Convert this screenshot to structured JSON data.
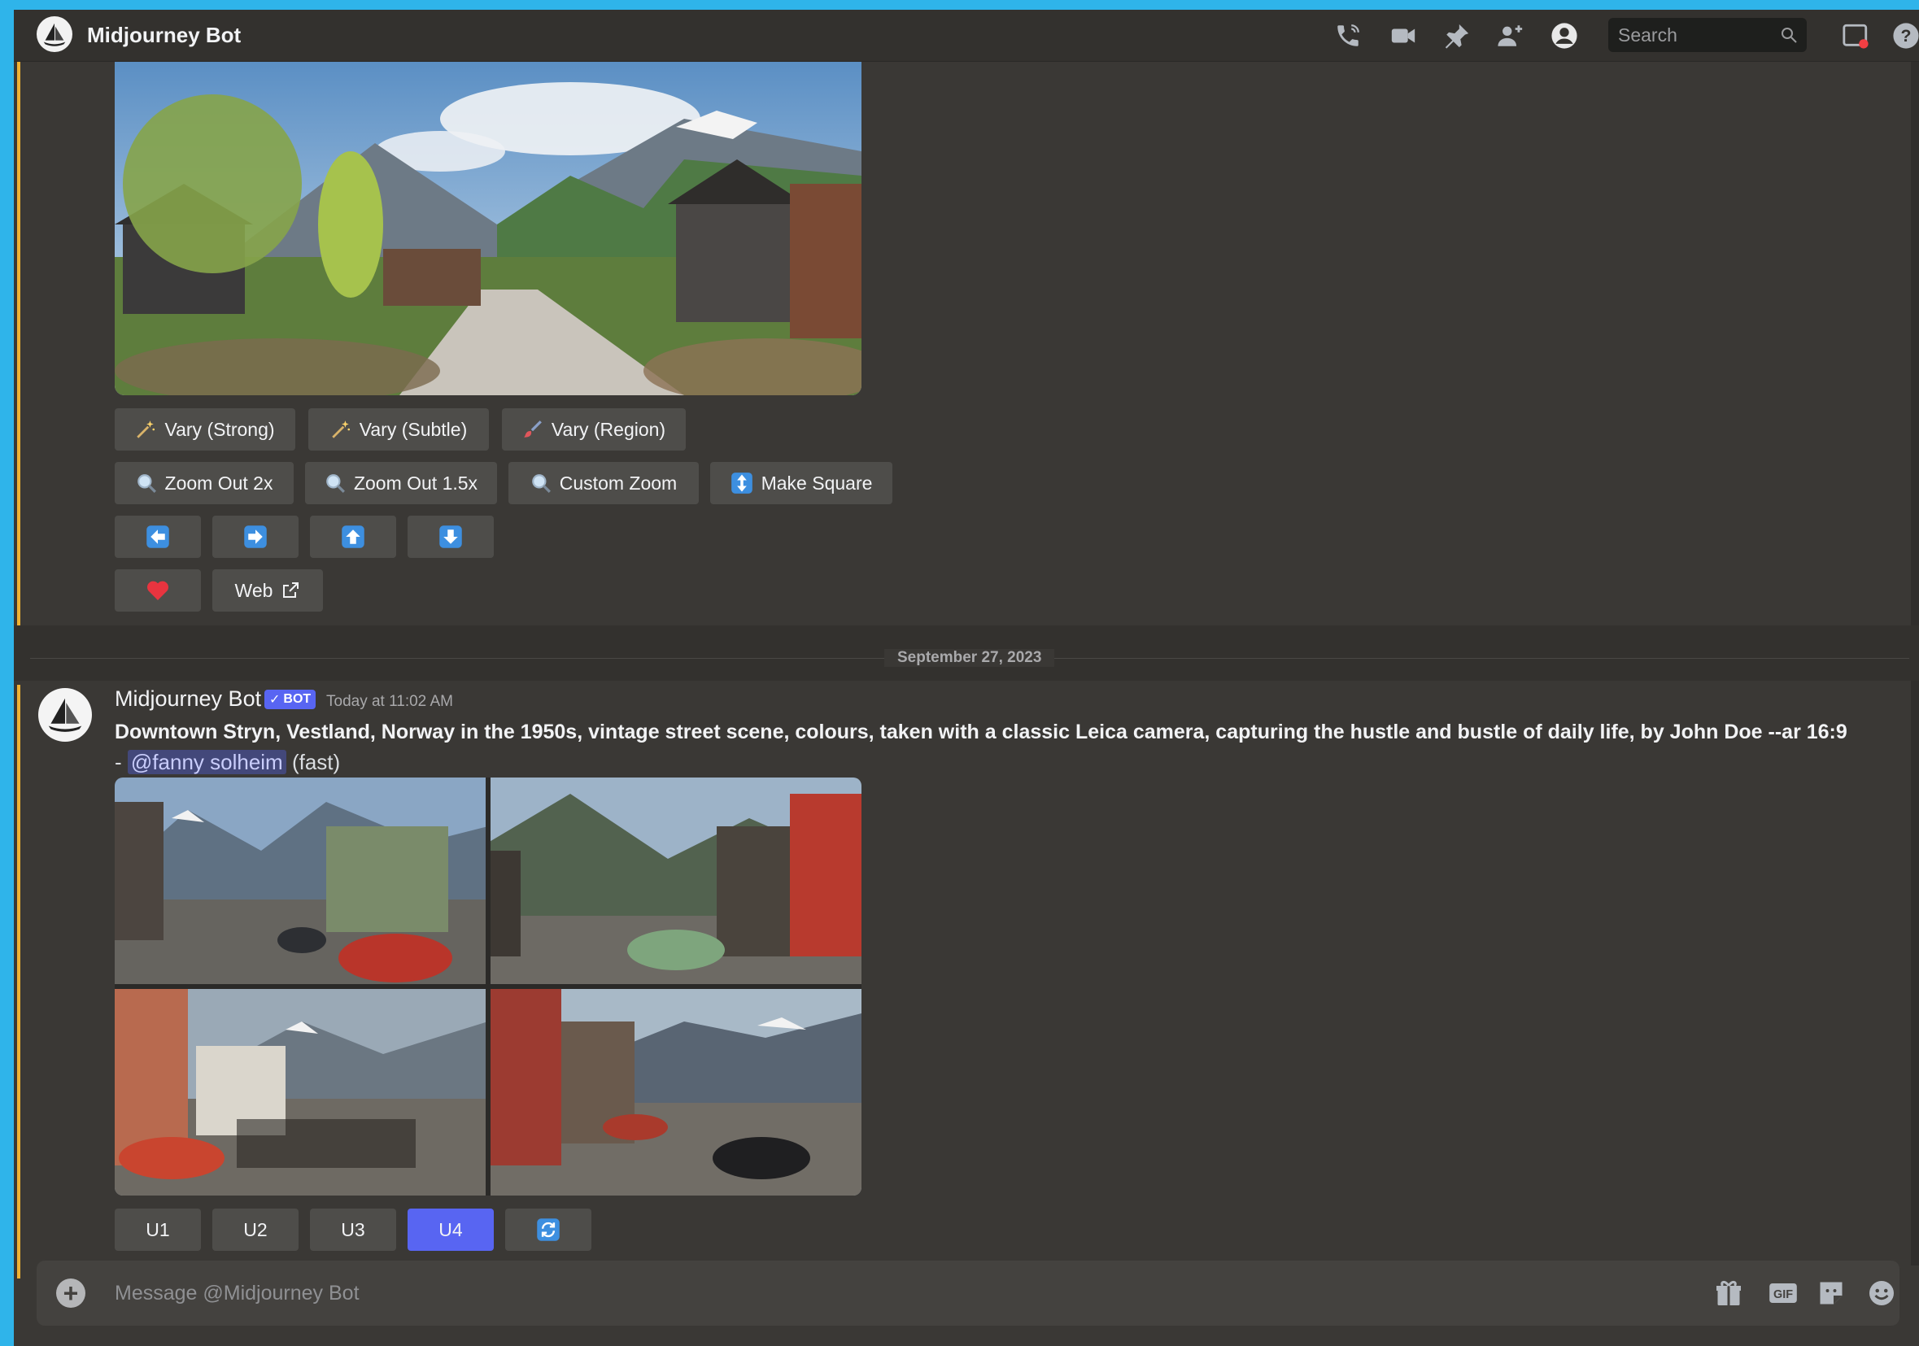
{
  "header": {
    "title": "Midjourney Bot",
    "search_placeholder": "Search"
  },
  "top_message": {
    "buttons_row1": [
      {
        "label": "Vary (Strong)",
        "icon": "magic-wand-icon"
      },
      {
        "label": "Vary (Subtle)",
        "icon": "magic-wand-icon"
      },
      {
        "label": "Vary (Region)",
        "icon": "paintbrush-icon"
      }
    ],
    "buttons_row2": [
      {
        "label": "Zoom Out 2x",
        "icon": "magnifier-icon"
      },
      {
        "label": "Zoom Out 1.5x",
        "icon": "magnifier-icon"
      },
      {
        "label": "Custom Zoom",
        "icon": "magnifier-icon"
      },
      {
        "label": "Make Square",
        "icon": "up-down-arrow-icon"
      }
    ],
    "pan_buttons": [
      "arrow-left-icon",
      "arrow-right-icon",
      "arrow-up-icon",
      "arrow-down-icon"
    ],
    "heart_icon": "heart-icon",
    "web_label": "Web"
  },
  "date_separator": "September 27, 2023",
  "message": {
    "author": "Midjourney Bot",
    "badge": "BOT",
    "timestamp": "Today at 11:02 AM",
    "prompt": "Downtown Stryn, Vestland, Norway in the 1950s, vintage street scene, colours, taken with a classic Leica camera, capturing the hustle and bustle of daily life, by John Doe --ar 16:9",
    "dash": "-",
    "mention": "@fanny solheim",
    "speed": "(fast)",
    "upscale_buttons": [
      "U1",
      "U2",
      "U3",
      "U4"
    ],
    "active_button": "U4",
    "reroll_icon": "reroll-icon"
  },
  "composer": {
    "placeholder": "Message @Midjourney Bot",
    "gif_label": "GIF"
  },
  "colors": {
    "accent": "#5865f2",
    "background": "#3a3835",
    "highlight": "#f0b232",
    "frame": "#2fb4ea"
  }
}
